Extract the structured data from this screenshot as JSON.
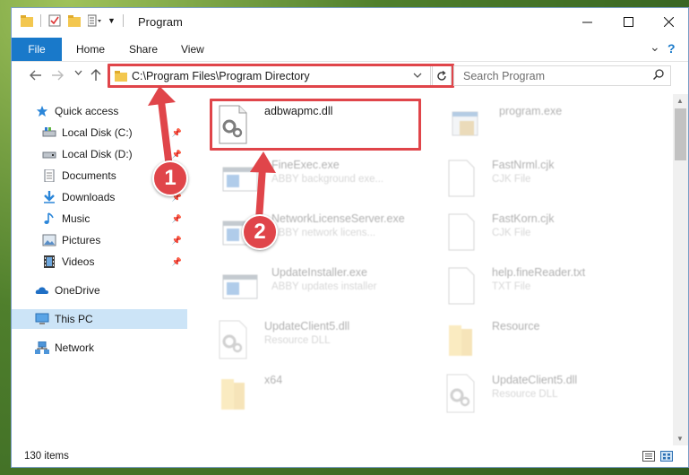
{
  "window": {
    "title": "Program"
  },
  "ribbon": {
    "tabs": [
      "File",
      "Home",
      "Share",
      "View"
    ],
    "expand_glyph": "⌄",
    "help_glyph": "?"
  },
  "address_bar": {
    "path": "C:\\Program Files\\Program Directory",
    "search_placeholder": "Search Program"
  },
  "sidebar": {
    "items": [
      {
        "label": "Quick access",
        "icon": "star-icon"
      },
      {
        "label": "Local Disk (C:)",
        "icon": "drive-icon",
        "pinned": true
      },
      {
        "label": "Local Disk (D:)",
        "icon": "drive-icon",
        "pinned": true
      },
      {
        "label": "Documents",
        "icon": "documents-icon",
        "pinned": true
      },
      {
        "label": "Downloads",
        "icon": "download-icon",
        "pinned": true
      },
      {
        "label": "Music",
        "icon": "music-icon",
        "pinned": true
      },
      {
        "label": "Pictures",
        "icon": "pictures-icon",
        "pinned": true
      },
      {
        "label": "Videos",
        "icon": "videos-icon",
        "pinned": true
      },
      {
        "label": "OneDrive",
        "icon": "cloud-icon"
      },
      {
        "label": "This PC",
        "icon": "computer-icon",
        "selected": true
      },
      {
        "label": "Network",
        "icon": "network-icon"
      }
    ]
  },
  "files": [
    {
      "name": "adbwapmc.dll",
      "desc": "",
      "icon": "dll-icon"
    },
    {
      "name": "program.exe",
      "desc": "",
      "icon": "exe-icon"
    },
    {
      "name": "FineExec.exe",
      "desc": "ABBY background exe...",
      "icon": "app-window-icon"
    },
    {
      "name": "FastNrml.cjk",
      "desc": "CJK File",
      "icon": "file-icon"
    },
    {
      "name": "NetworkLicenseServer.exe",
      "desc": "ABBY network licens...",
      "icon": "app-window-icon"
    },
    {
      "name": "FastKorn.cjk",
      "desc": "CJK File",
      "icon": "file-icon"
    },
    {
      "name": "UpdateInstaller.exe",
      "desc": "ABBY updates installer",
      "icon": "app-window-icon"
    },
    {
      "name": "help.fineReader.txt",
      "desc": "TXT File",
      "icon": "file-icon"
    },
    {
      "name": "UpdateClient5.dll",
      "desc": "Resource DLL",
      "icon": "dll-icon"
    },
    {
      "name": "Resource",
      "desc": "",
      "icon": "folder-icon"
    },
    {
      "name": "x64",
      "desc": "",
      "icon": "folder-icon"
    },
    {
      "name": "UpdateClient5.dll",
      "desc": "Resource DLL",
      "icon": "dll-icon"
    }
  ],
  "status": {
    "item_count": "130 items"
  },
  "callouts": [
    "1",
    "2"
  ],
  "colors": {
    "accent": "#1979ca",
    "highlight": "#e0454a",
    "selected": "#cce4f7"
  }
}
